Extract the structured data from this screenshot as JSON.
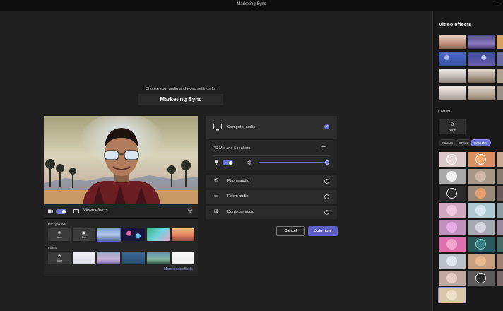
{
  "window": {
    "title": "Marketing Sync"
  },
  "prejoin": {
    "prompt": "Choose your audio and video settings for",
    "meeting_name": "Marketing Sync"
  },
  "video_bar": {
    "camera_on": true,
    "video_effects_label": "Video effects"
  },
  "effects_panel": {
    "backgrounds_label": "Backgrounds",
    "none_label": "None",
    "blur_label": "Blur",
    "filters_label": "Filters",
    "more_link": "More video effects"
  },
  "audio": {
    "computer_audio": {
      "label": "Computer audio",
      "selected": true
    },
    "device_label": "PC Mic and Speakers",
    "mic_on": true,
    "speaker_volume": 1.0,
    "phone_audio": {
      "label": "Phone audio",
      "selected": false
    },
    "room_audio": {
      "label": "Room audio",
      "selected": false
    },
    "no_audio": {
      "label": "Don't use audio",
      "selected": false
    }
  },
  "actions": {
    "cancel": "Cancel",
    "join": "Join now"
  },
  "side_panel": {
    "title": "Video effects",
    "filters_label": "Filters",
    "none_label": "None",
    "tabs": [
      {
        "label": "Frames",
        "active": false
      },
      {
        "label": "Styles",
        "active": false
      },
      {
        "label": "Snapchat",
        "active": true
      }
    ]
  },
  "icons": {
    "camera": "camera-icon",
    "effects": "video-effects-icon",
    "settings": "gear-icon",
    "computer": "computer-icon",
    "adjust": "sliders-icon",
    "mic": "microphone-icon",
    "speaker": "speaker-icon",
    "phone": "phone-icon",
    "room": "room-icon",
    "no_audio": "no-audio-icon",
    "minimize": "minimize-icon"
  }
}
